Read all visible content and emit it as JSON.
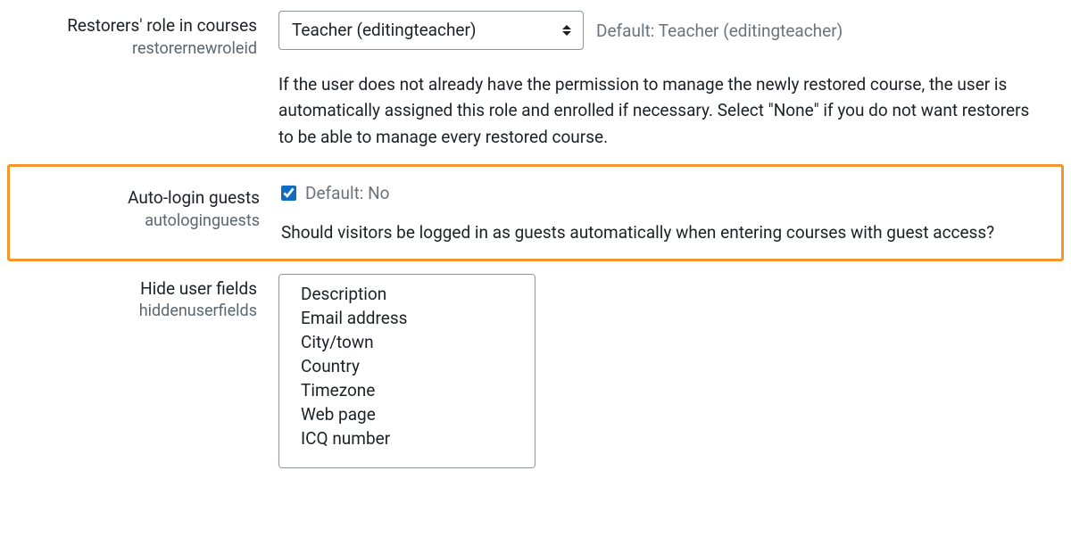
{
  "settings": {
    "restorerRole": {
      "label": "Restorers' role in courses",
      "id": "restorernewroleid",
      "selectValue": "Teacher (editingteacher)",
      "defaultHint": "Default: Teacher (editingteacher)",
      "description": "If the user does not already have the permission to manage the newly restored course, the user is automatically assigned this role and enrolled if necessary. Select \"None\" if you do not want restorers to be able to manage every restored course."
    },
    "autoLoginGuests": {
      "label": "Auto-login guests",
      "id": "autologinguests",
      "checked": true,
      "defaultHint": "Default: No",
      "description": "Should visitors be logged in as guests automatically when entering courses with guest access?"
    },
    "hiddenUserFields": {
      "label": "Hide user fields",
      "id": "hiddenuserfields",
      "options": [
        "Description",
        "Email address",
        "City/town",
        "Country",
        "Timezone",
        "Web page",
        "ICQ number"
      ]
    }
  }
}
